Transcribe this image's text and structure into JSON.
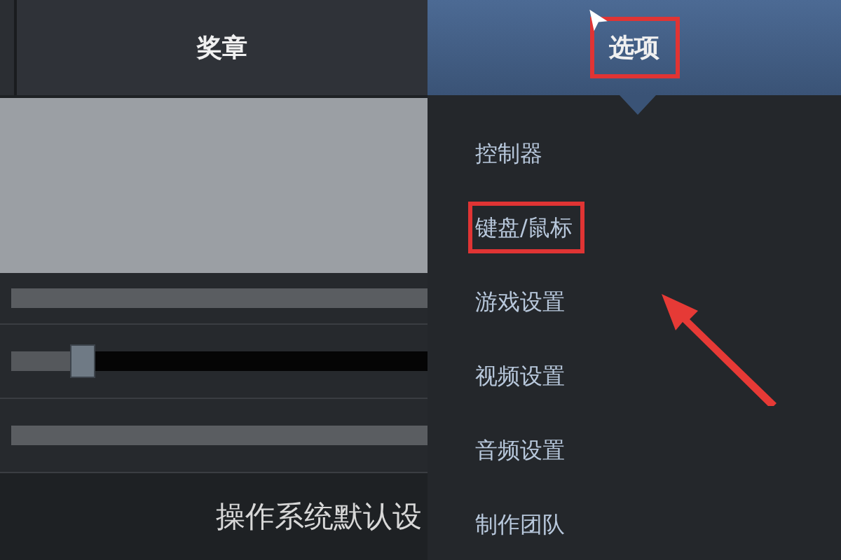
{
  "tabs": [
    {
      "label": "奖章",
      "selected": false,
      "annotated": false
    },
    {
      "label": "选项",
      "selected": true,
      "annotated": true
    }
  ],
  "menu": {
    "items": [
      {
        "label": "控制器",
        "annotated": false
      },
      {
        "label": "键盘/鼠标",
        "annotated": true
      },
      {
        "label": "游戏设置",
        "annotated": false
      },
      {
        "label": "视频设置",
        "annotated": false
      },
      {
        "label": "音频设置",
        "annotated": false
      },
      {
        "label": "制作团队",
        "annotated": false
      }
    ]
  },
  "settings": {
    "slider": {
      "level": 0.15
    },
    "device_label": "操作系统默认设"
  }
}
